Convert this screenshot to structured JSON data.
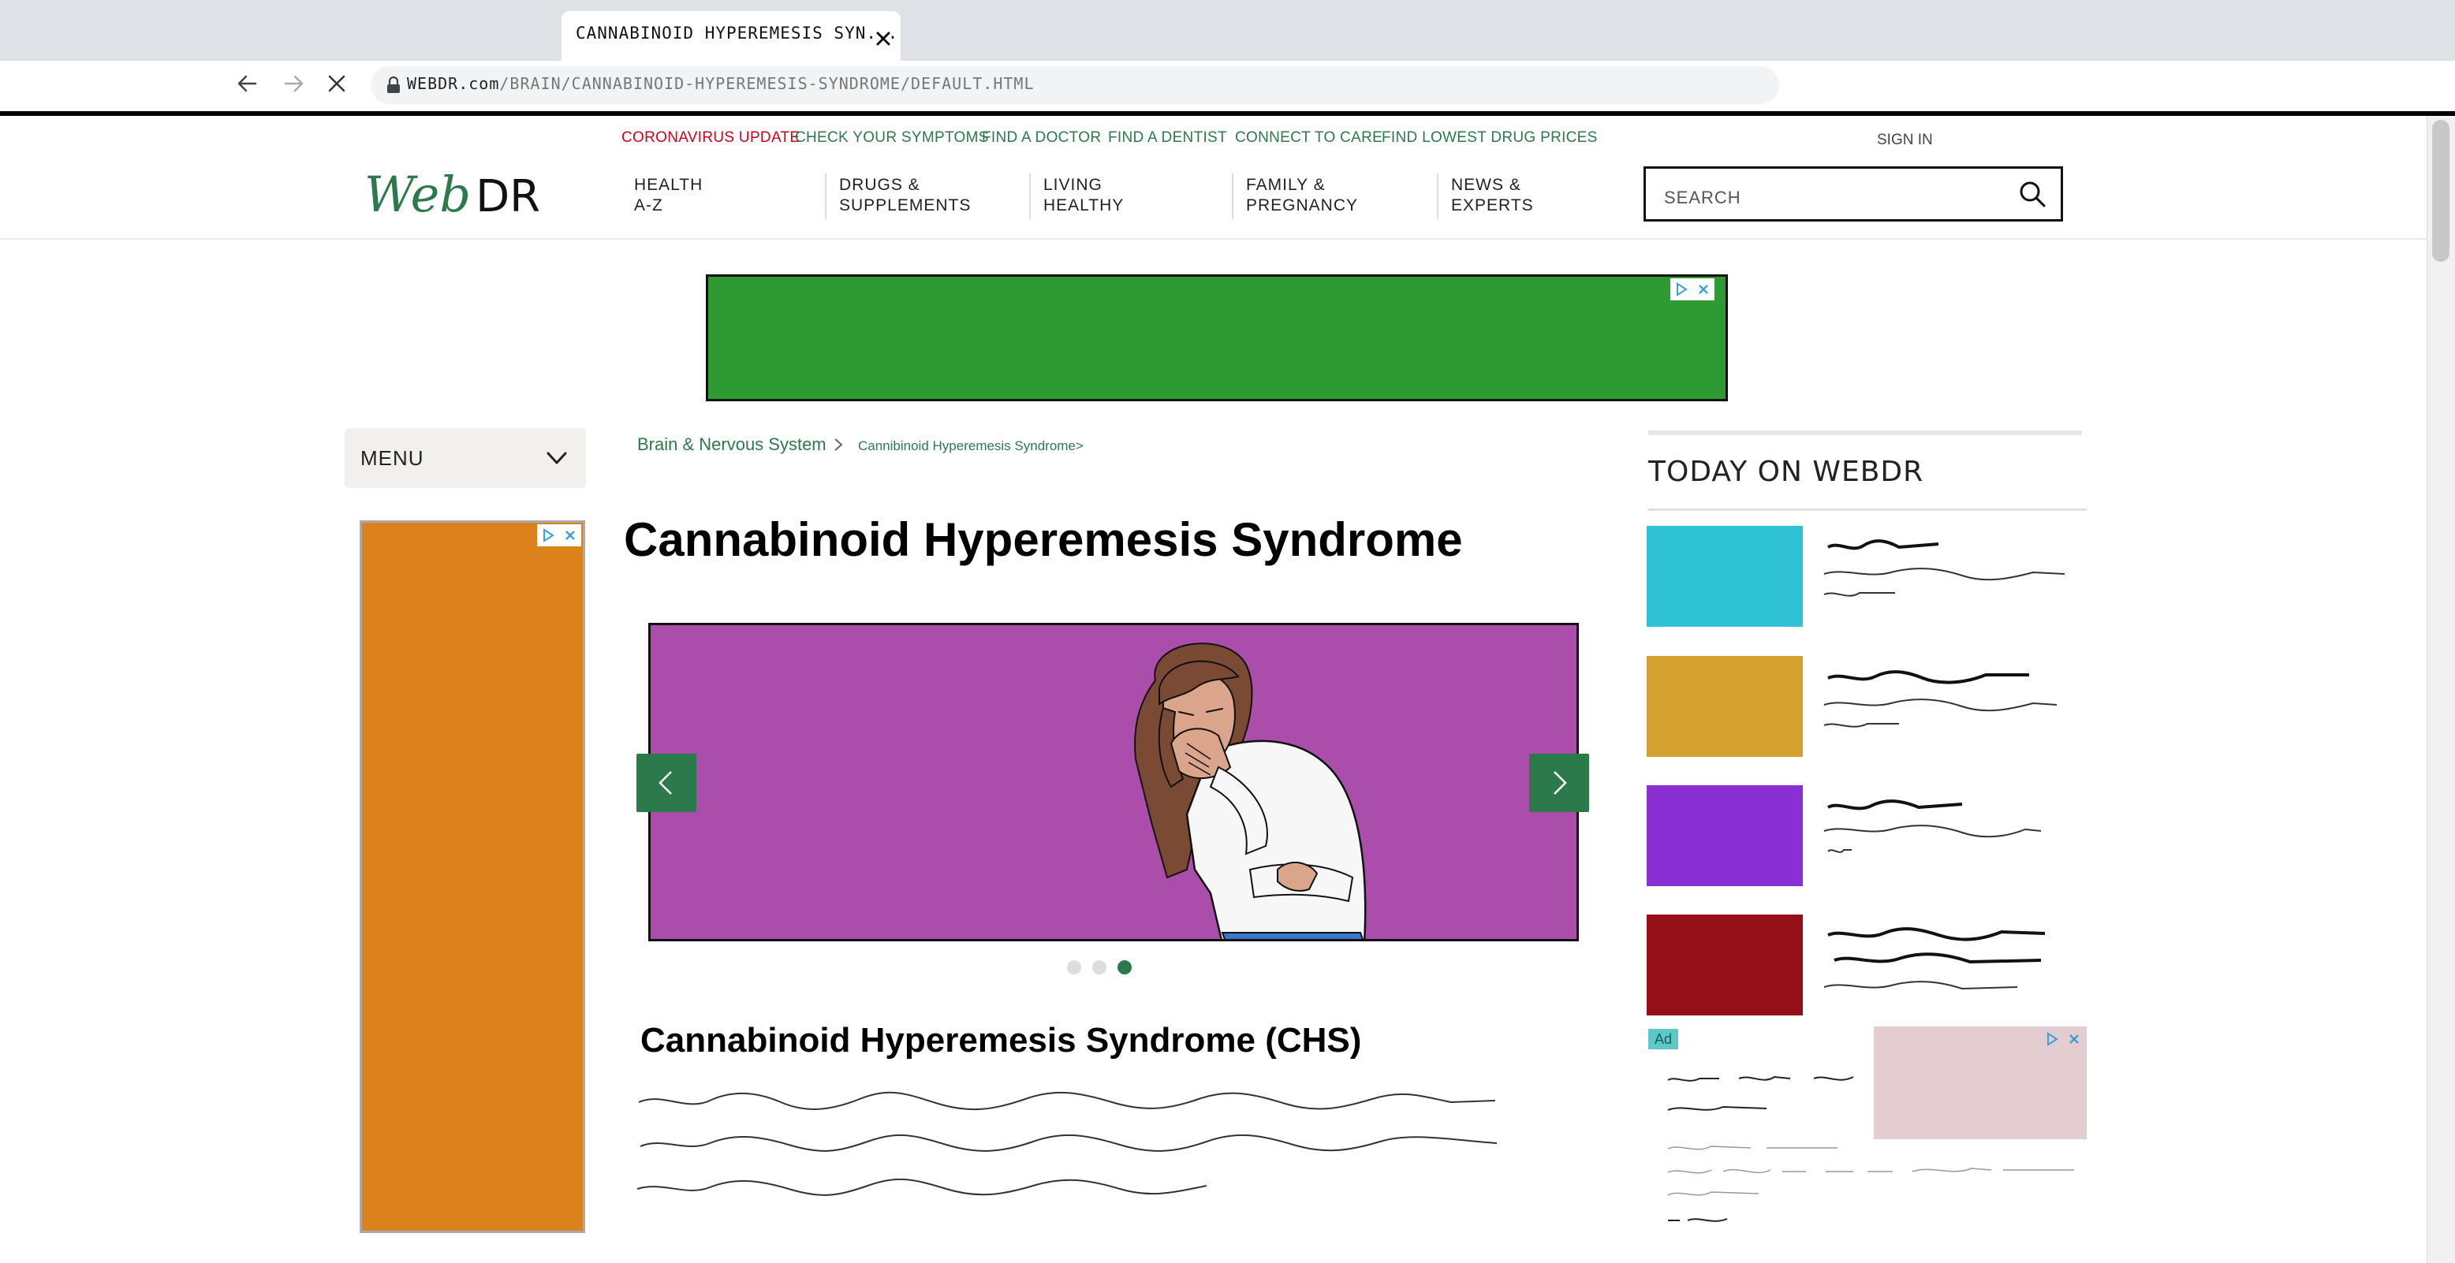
{
  "browser": {
    "tab_title": "CANNABINOID HYPEREMESIS SYN...",
    "url_domain": "WEBDR.com",
    "url_path": "/BRAIN/CANNABINOID-HYPEREMESIS-SYNDROME/DEFAULT.HTML"
  },
  "utility_nav": {
    "covid": "Coronavirus Update",
    "symptoms": "Check Your Symptoms",
    "doctor": "Find a Doctor",
    "dentist": "Find a Dentist",
    "care": "Connect to Care",
    "drug": "Find Lowest Drug Prices",
    "signin": "Sign In"
  },
  "logo": {
    "web": "Web",
    "dr": "DR"
  },
  "main_nav": [
    {
      "line1": "Health",
      "line2": "A-Z"
    },
    {
      "line1": "Drugs &",
      "line2": "Supplements"
    },
    {
      "line1": "Living",
      "line2": "Healthy"
    },
    {
      "line1": "Family &",
      "line2": "Pregnancy"
    },
    {
      "line1": "News &",
      "line2": "Experts"
    }
  ],
  "search": {
    "placeholder": "Search"
  },
  "sidebar": {
    "menu_label": "Menu"
  },
  "breadcrumb": {
    "level1": "Brain & Nervous System",
    "level2": "Cannibinoid Hyperemesis Syndrome>"
  },
  "article": {
    "title": "Cannabinoid Hyperemesis Syndrome",
    "section_heading": "Cannabinoid Hyperemesis Syndrome (CHS)"
  },
  "carousel": {
    "slide_count": 3,
    "active_index": 3
  },
  "today": {
    "heading": "Today on WebDR"
  },
  "ad": {
    "label": "Ad"
  },
  "colors": {
    "brand_green": "#2c7a4b",
    "covid_red": "#d0021b",
    "top_ad": "#2d9b31",
    "side_ad": "#db821c",
    "slide_bg": "#ab4daa",
    "today_thumbs": [
      "#2fc2d4",
      "#d4a02f",
      "#8a2fd4",
      "#940f18"
    ],
    "sponsor_img": "#e3cdd1"
  }
}
